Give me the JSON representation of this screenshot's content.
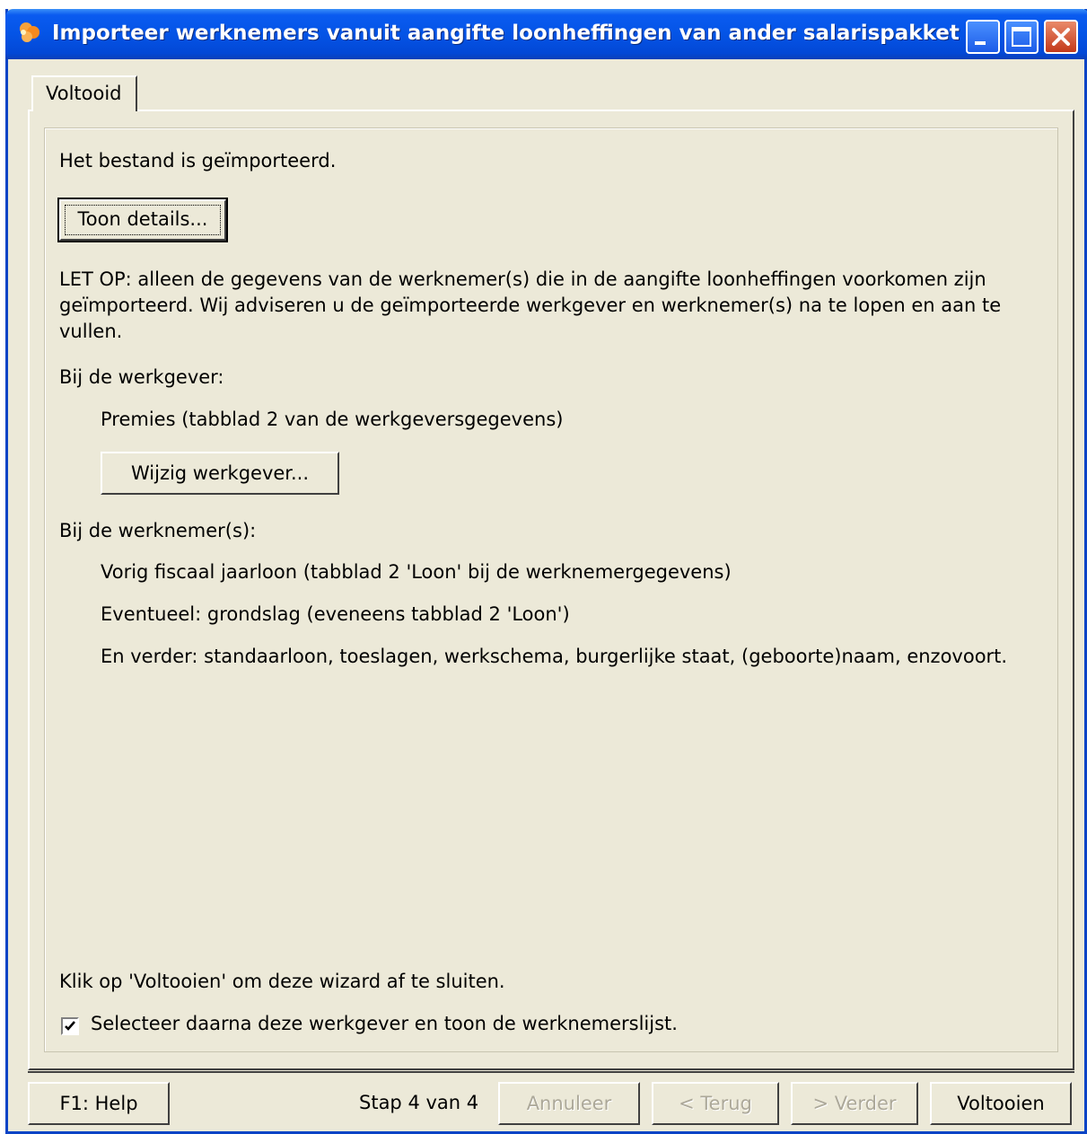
{
  "window": {
    "title": "Importeer werknemers vanuit aangifte loonheffingen van ander salarispakket"
  },
  "tab": {
    "label": "Voltooid"
  },
  "content": {
    "imported_text": "Het bestand is geïmporteerd.",
    "details_button": "Toon details...",
    "warning": "LET OP: alleen de gegevens van de werknemer(s) die in de aangifte loonheffingen voorkomen zijn geïmporteerd. Wij adviseren u de geïmporteerde werkgever en werknemer(s) na te lopen en aan te vullen.",
    "employer_heading": "Bij de werkgever:",
    "employer_item": "Premies (tabblad 2 van de werkgeversgegevens)",
    "change_employer_button": "Wijzig werkgever...",
    "employees_heading": "Bij de werknemer(s):",
    "employee_items": [
      "Vorig fiscaal jaarloon (tabblad 2 'Loon' bij de werknemergegevens)",
      "Eventueel: grondslag (eveneens tabblad 2 'Loon')",
      "En verder: standaarloon, toeslagen, werkschema, burgerlijke staat, (geboorte)naam, enzovoort."
    ],
    "finish_hint": "Klik op 'Voltooien' om deze wizard af te sluiten.",
    "checkbox_label": "Selecteer daarna deze werkgever en toon de werknemerslijst.",
    "checkbox_checked": true
  },
  "footer": {
    "help_button": "F1: Help",
    "step_text": "Stap 4 van  4",
    "cancel_button": "Annuleer",
    "back_button": "< Terug",
    "next_button": "> Verder",
    "finish_button": "Voltooien"
  },
  "colors": {
    "titlebar": "#0454e6",
    "window_bg": "#ece9d8",
    "close_button": "#c3391a",
    "disabled_text": "#aca899"
  },
  "icons": [
    "app-icon",
    "minimize-icon",
    "restore-icon",
    "close-icon",
    "checkmark-icon"
  ]
}
